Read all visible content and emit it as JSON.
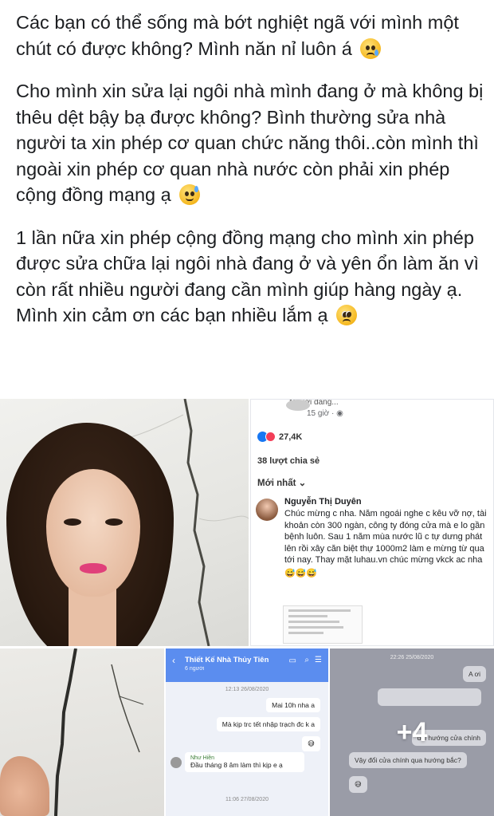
{
  "post": {
    "paragraphs": [
      "Các bạn có thể sống mà bớt nghiệt ngã với mình một chút có được không? Mình năn nỉ luôn á",
      "Cho mình xin sửa lại ngôi nhà mình đang ở mà không bị thêu dệt bậy bạ được không? Bình thường sửa nhà người ta xin phép cơ quan chức năng thôi..còn mình thì ngoài xin phép cơ quan nhà nước còn phải xin phép cộng đồng mạng ạ",
      "1 lần nữa xin phép cộng đồng mạng cho mình xin phép được sửa chữa lại ngôi nhà đang ở và yên ổn làm ăn vì còn rất nhiều người đang cần mình giúp hàng ngày ạ.  Mình xin cảm ơn các bạn nhiều lắm ạ"
    ],
    "emojis": [
      "crying-face-emoji",
      "sweat-smile-emoji",
      "pleading-face-emoji"
    ]
  },
  "fb_screenshot": {
    "poster": "Người đang...",
    "time": "15 giờ",
    "reaction_count": "27,4K",
    "shares": "38 lượt chia sẻ",
    "sort": "Mới nhất",
    "comment": {
      "name": "Nguyễn Thị Duyên",
      "text": "Chúc mừng c nha. Năm ngoái nghe c kêu vỡ nợ, tài khoản còn 300 ngàn, công ty đóng cửa mà e lo gần bệnh luôn. Sau 1 năm mùa nước lũ c tự dưng phát lên rồi xây căn biệt thự 1000m2 làm e mừng từ qua tới nay. Thay mặt luhau.vn chúc mừng vkck ac nha",
      "emojis": "😅😅😅"
    }
  },
  "chat": {
    "title": "Thiết Kế Nhà Thủy Tiên",
    "subtitle": "6 người",
    "date1": "12:13 26/08/2020",
    "msg1": "Mai 10h nha a",
    "msg2": "Mà kịp trc tết nhập trạch đc k a",
    "reply_name": "Như Hiền",
    "reply_text": "Đầu tháng 8 âm làm thì kịp e ạ",
    "date2": "11:06 27/08/2020"
  },
  "chat2": {
    "date": "22:26 25/08/2020",
    "msg1": "A ơi",
    "msg2": "đổi hướng cửa chính",
    "msg3": "Vậy đổi cửa chính qua hướng bắc?",
    "more": "+4"
  }
}
